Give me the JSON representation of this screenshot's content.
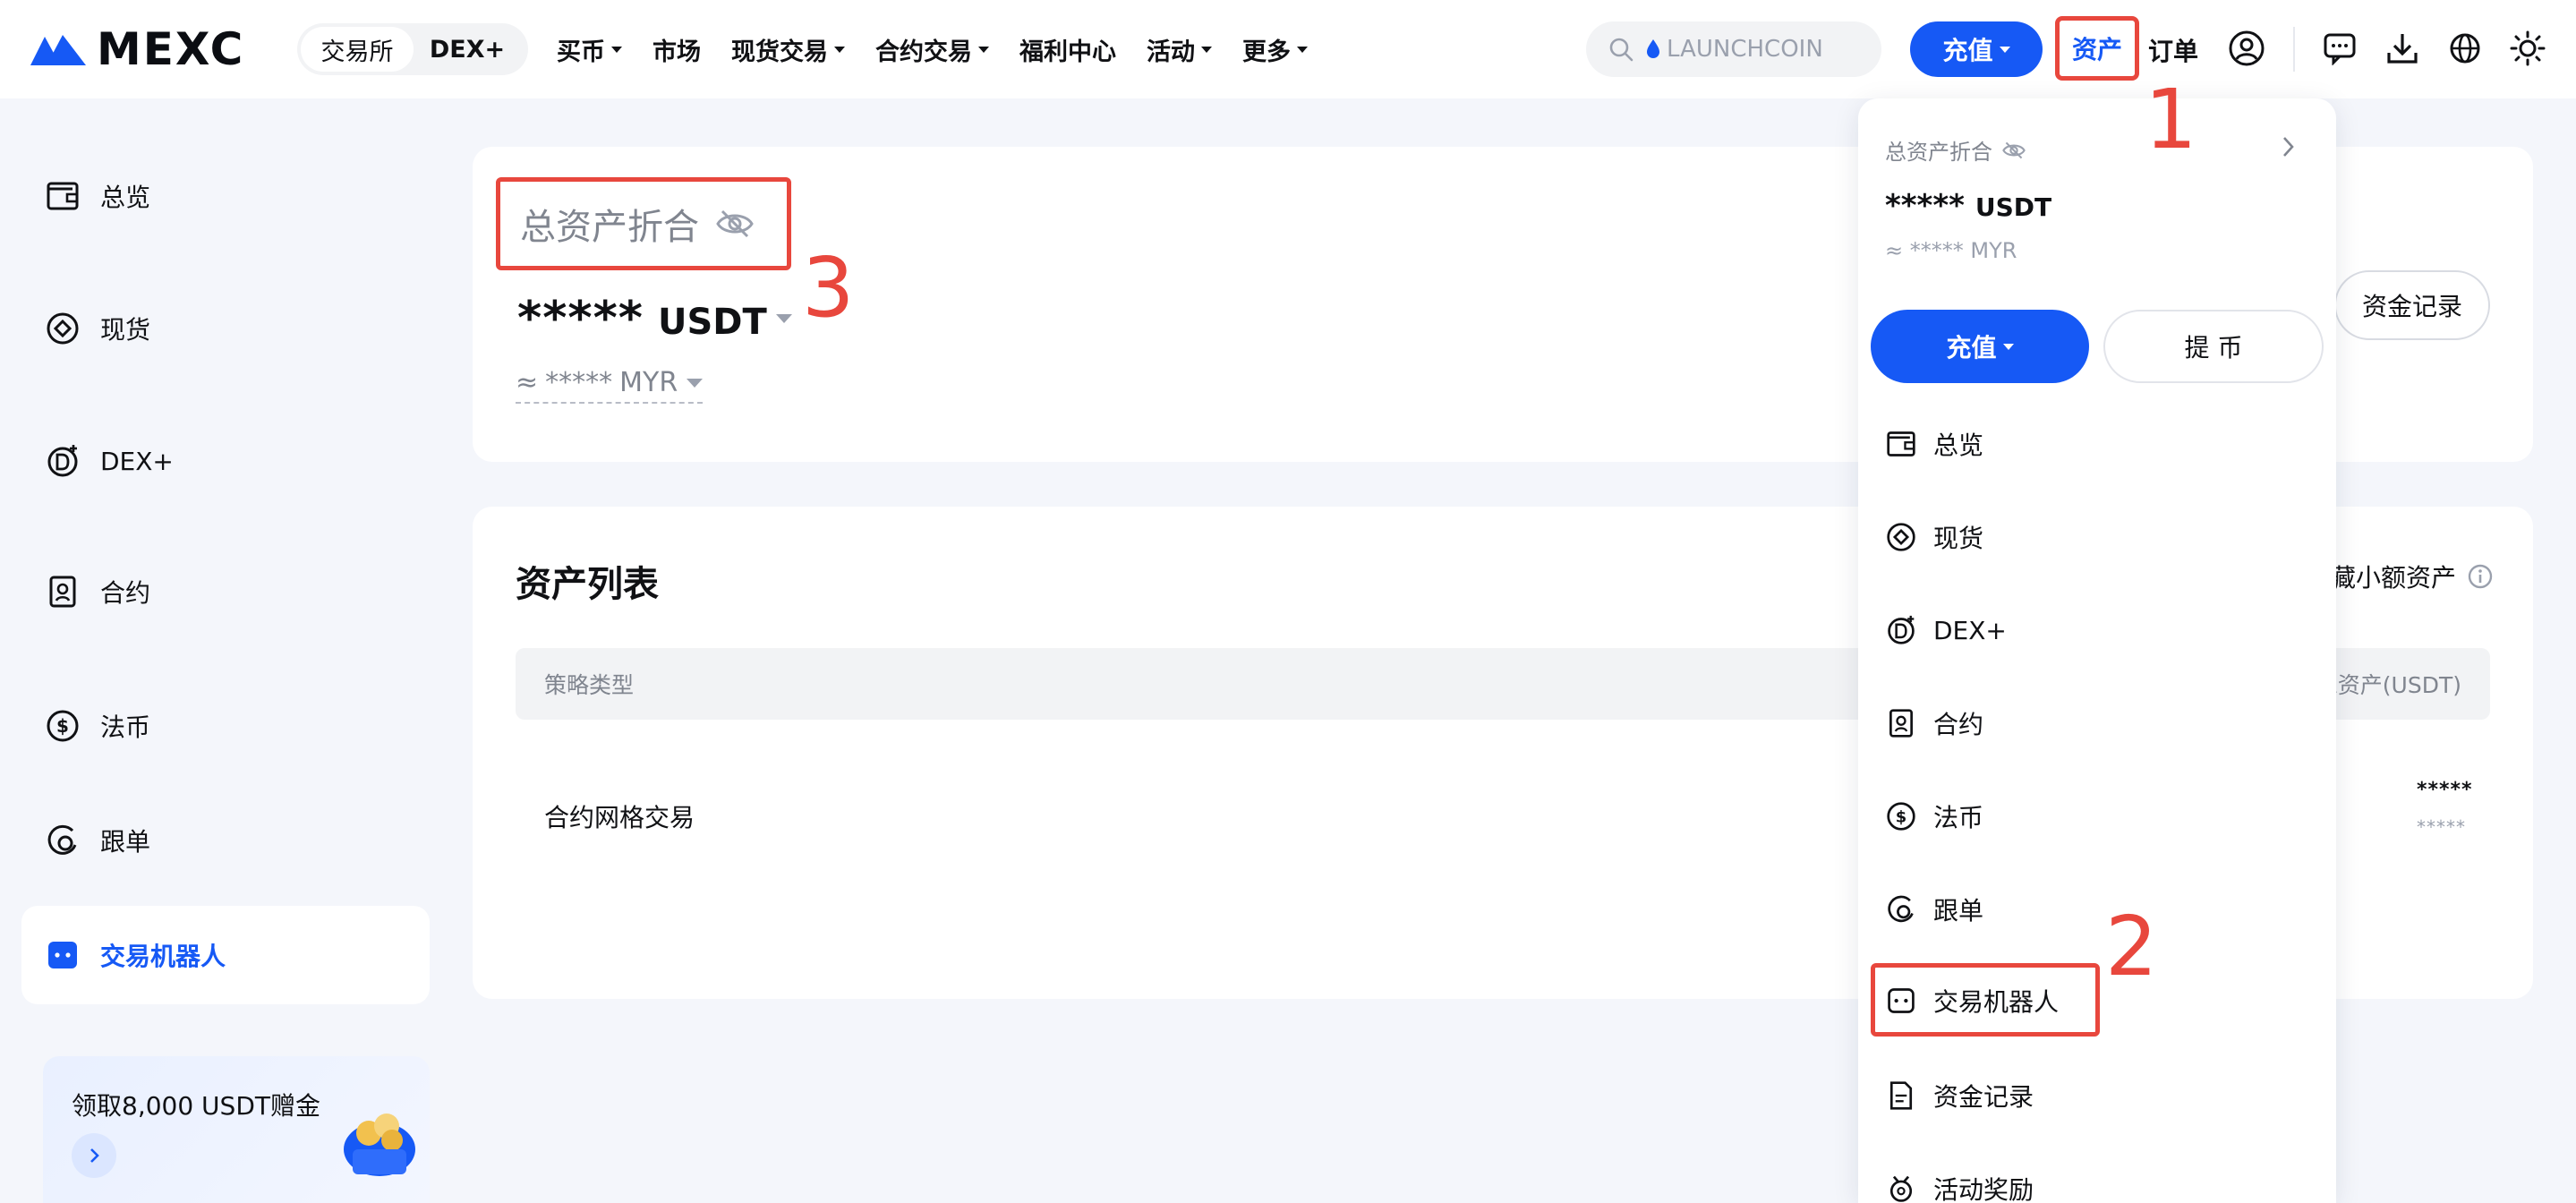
{
  "header": {
    "logo_text": "MEXC",
    "segment": [
      "交易所",
      "DEX+"
    ],
    "nav": [
      {
        "label": "买币",
        "dropdown": true
      },
      {
        "label": "市场",
        "dropdown": false
      },
      {
        "label": "现货交易",
        "dropdown": true
      },
      {
        "label": "合约交易",
        "dropdown": true
      },
      {
        "label": "福利中心",
        "dropdown": false
      },
      {
        "label": "活动",
        "dropdown": true
      },
      {
        "label": "更多",
        "dropdown": true
      }
    ],
    "search_placeholder": "LAUNCHCOIN",
    "deposit_label": "充值",
    "assets_label": "资产",
    "orders_label": "订单"
  },
  "annotations": [
    "1",
    "2",
    "3"
  ],
  "sidebar": {
    "items": [
      {
        "label": "总览",
        "icon": "wallet-icon"
      },
      {
        "label": "现货",
        "icon": "spot-icon"
      },
      {
        "label": "DEX+",
        "icon": "dex-icon"
      },
      {
        "label": "合约",
        "icon": "contract-icon"
      },
      {
        "label": "法币",
        "icon": "dollar-icon"
      },
      {
        "label": "跟单",
        "icon": "copy-trade-icon"
      },
      {
        "label": "交易机器人",
        "icon": "robot-icon",
        "active": true
      }
    ],
    "promo_text": "领取8,000 USDT赠金"
  },
  "overview": {
    "total_label": "总资产折合",
    "amount": "*****",
    "unit": "USDT",
    "approx_prefix": "≈",
    "approx_value": "*****",
    "approx_currency": "MYR",
    "fund_record_label": "资金记录"
  },
  "asset_list": {
    "title": "资产列表",
    "hide_small_label": "藏小额资产",
    "columns": [
      "策略类型",
      "总资产(USDT)"
    ],
    "rows": [
      {
        "name": "合约网格交易",
        "value": "*****",
        "sub_value": "*****"
      }
    ]
  },
  "dropdown": {
    "total_label": "总资产折合",
    "amount": "*****",
    "unit": "USDT",
    "approx": "≈ ***** MYR",
    "deposit_label": "充值",
    "withdraw_label": "提 币",
    "items": [
      {
        "label": "总览",
        "icon": "wallet-icon"
      },
      {
        "label": "现货",
        "icon": "spot-icon"
      },
      {
        "label": "DEX+",
        "icon": "dex-icon"
      },
      {
        "label": "合约",
        "icon": "contract-icon"
      },
      {
        "label": "法币",
        "icon": "dollar-icon"
      },
      {
        "label": "跟单",
        "icon": "copy-trade-icon"
      },
      {
        "label": "交易机器人",
        "icon": "robot-icon"
      },
      {
        "label": "资金记录",
        "icon": "document-icon"
      },
      {
        "label": "活动奖励",
        "icon": "reward-icon"
      }
    ]
  },
  "colors": {
    "brand_blue": "#1659f5",
    "annotation_red": "#e8473d",
    "background": "#f4f6fb"
  }
}
